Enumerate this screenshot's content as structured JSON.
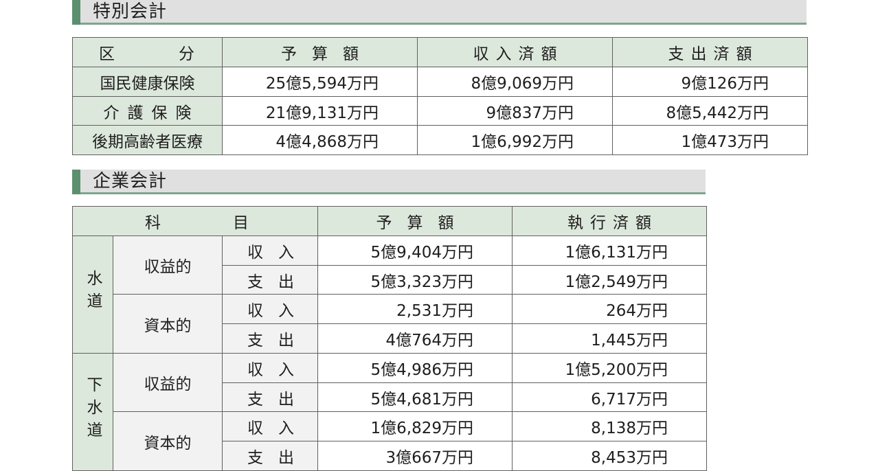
{
  "special": {
    "title": "特別会計",
    "headers": {
      "category": [
        "区",
        "分"
      ],
      "budget": "予算額",
      "received": "収入済額",
      "spent": "支出済額"
    },
    "rows": [
      {
        "name": "国民健康保険",
        "budget": "25億5,594万円",
        "received": "8億9,069万円",
        "spent": "9億126万円"
      },
      {
        "name": "介護保険",
        "budget": "21億9,131万円",
        "received": "9億837万円",
        "spent": "8億5,442万円"
      },
      {
        "name": "後期高齢者医療",
        "budget": "4億4,868万円",
        "received": "1億6,992万円",
        "spent": "1億473万円"
      }
    ]
  },
  "enterprise": {
    "title": "企業会計",
    "headers": {
      "item": [
        "科",
        "目"
      ],
      "budget": "予算額",
      "executed": "執行済額"
    },
    "groups": [
      {
        "name": "水道",
        "sections": [
          {
            "name": "収益的",
            "rows": [
              {
                "type": [
                  "収",
                  "入"
                ],
                "budget": "5億9,404万円",
                "executed": "1億6,131万円"
              },
              {
                "type": [
                  "支",
                  "出"
                ],
                "budget": "5億3,323万円",
                "executed": "1億2,549万円"
              }
            ]
          },
          {
            "name": "資本的",
            "rows": [
              {
                "type": [
                  "収",
                  "入"
                ],
                "budget": "2,531万円",
                "executed": "264万円"
              },
              {
                "type": [
                  "支",
                  "出"
                ],
                "budget": "4億764万円",
                "executed": "1,445万円"
              }
            ]
          }
        ]
      },
      {
        "name": "下水道",
        "sections": [
          {
            "name": "収益的",
            "rows": [
              {
                "type": [
                  "収",
                  "入"
                ],
                "budget": "5億4,986万円",
                "executed": "1億5,200万円"
              },
              {
                "type": [
                  "支",
                  "出"
                ],
                "budget": "5億4,681万円",
                "executed": "6,717万円"
              }
            ]
          },
          {
            "name": "資本的",
            "rows": [
              {
                "type": [
                  "収",
                  "入"
                ],
                "budget": "1億6,829万円",
                "executed": "8,138万円"
              },
              {
                "type": [
                  "支",
                  "出"
                ],
                "budget": "3億667万円",
                "executed": "8,453万円"
              }
            ]
          }
        ]
      }
    ]
  }
}
